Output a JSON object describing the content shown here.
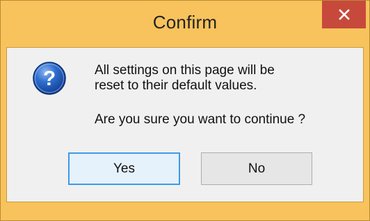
{
  "dialog": {
    "title": "Confirm",
    "close_icon": "close-icon",
    "message_lines": [
      "All settings on this page will be",
      "reset to their default values."
    ],
    "question": "Are you sure you want to continue ?",
    "icon": "question-icon",
    "buttons": {
      "yes": "Yes",
      "no": "No"
    }
  },
  "colors": {
    "titlebar": "#f8c35c",
    "close_button": "#c7493b",
    "client_background": "#f0f0f0",
    "default_button_border": "#3c9ae6"
  }
}
